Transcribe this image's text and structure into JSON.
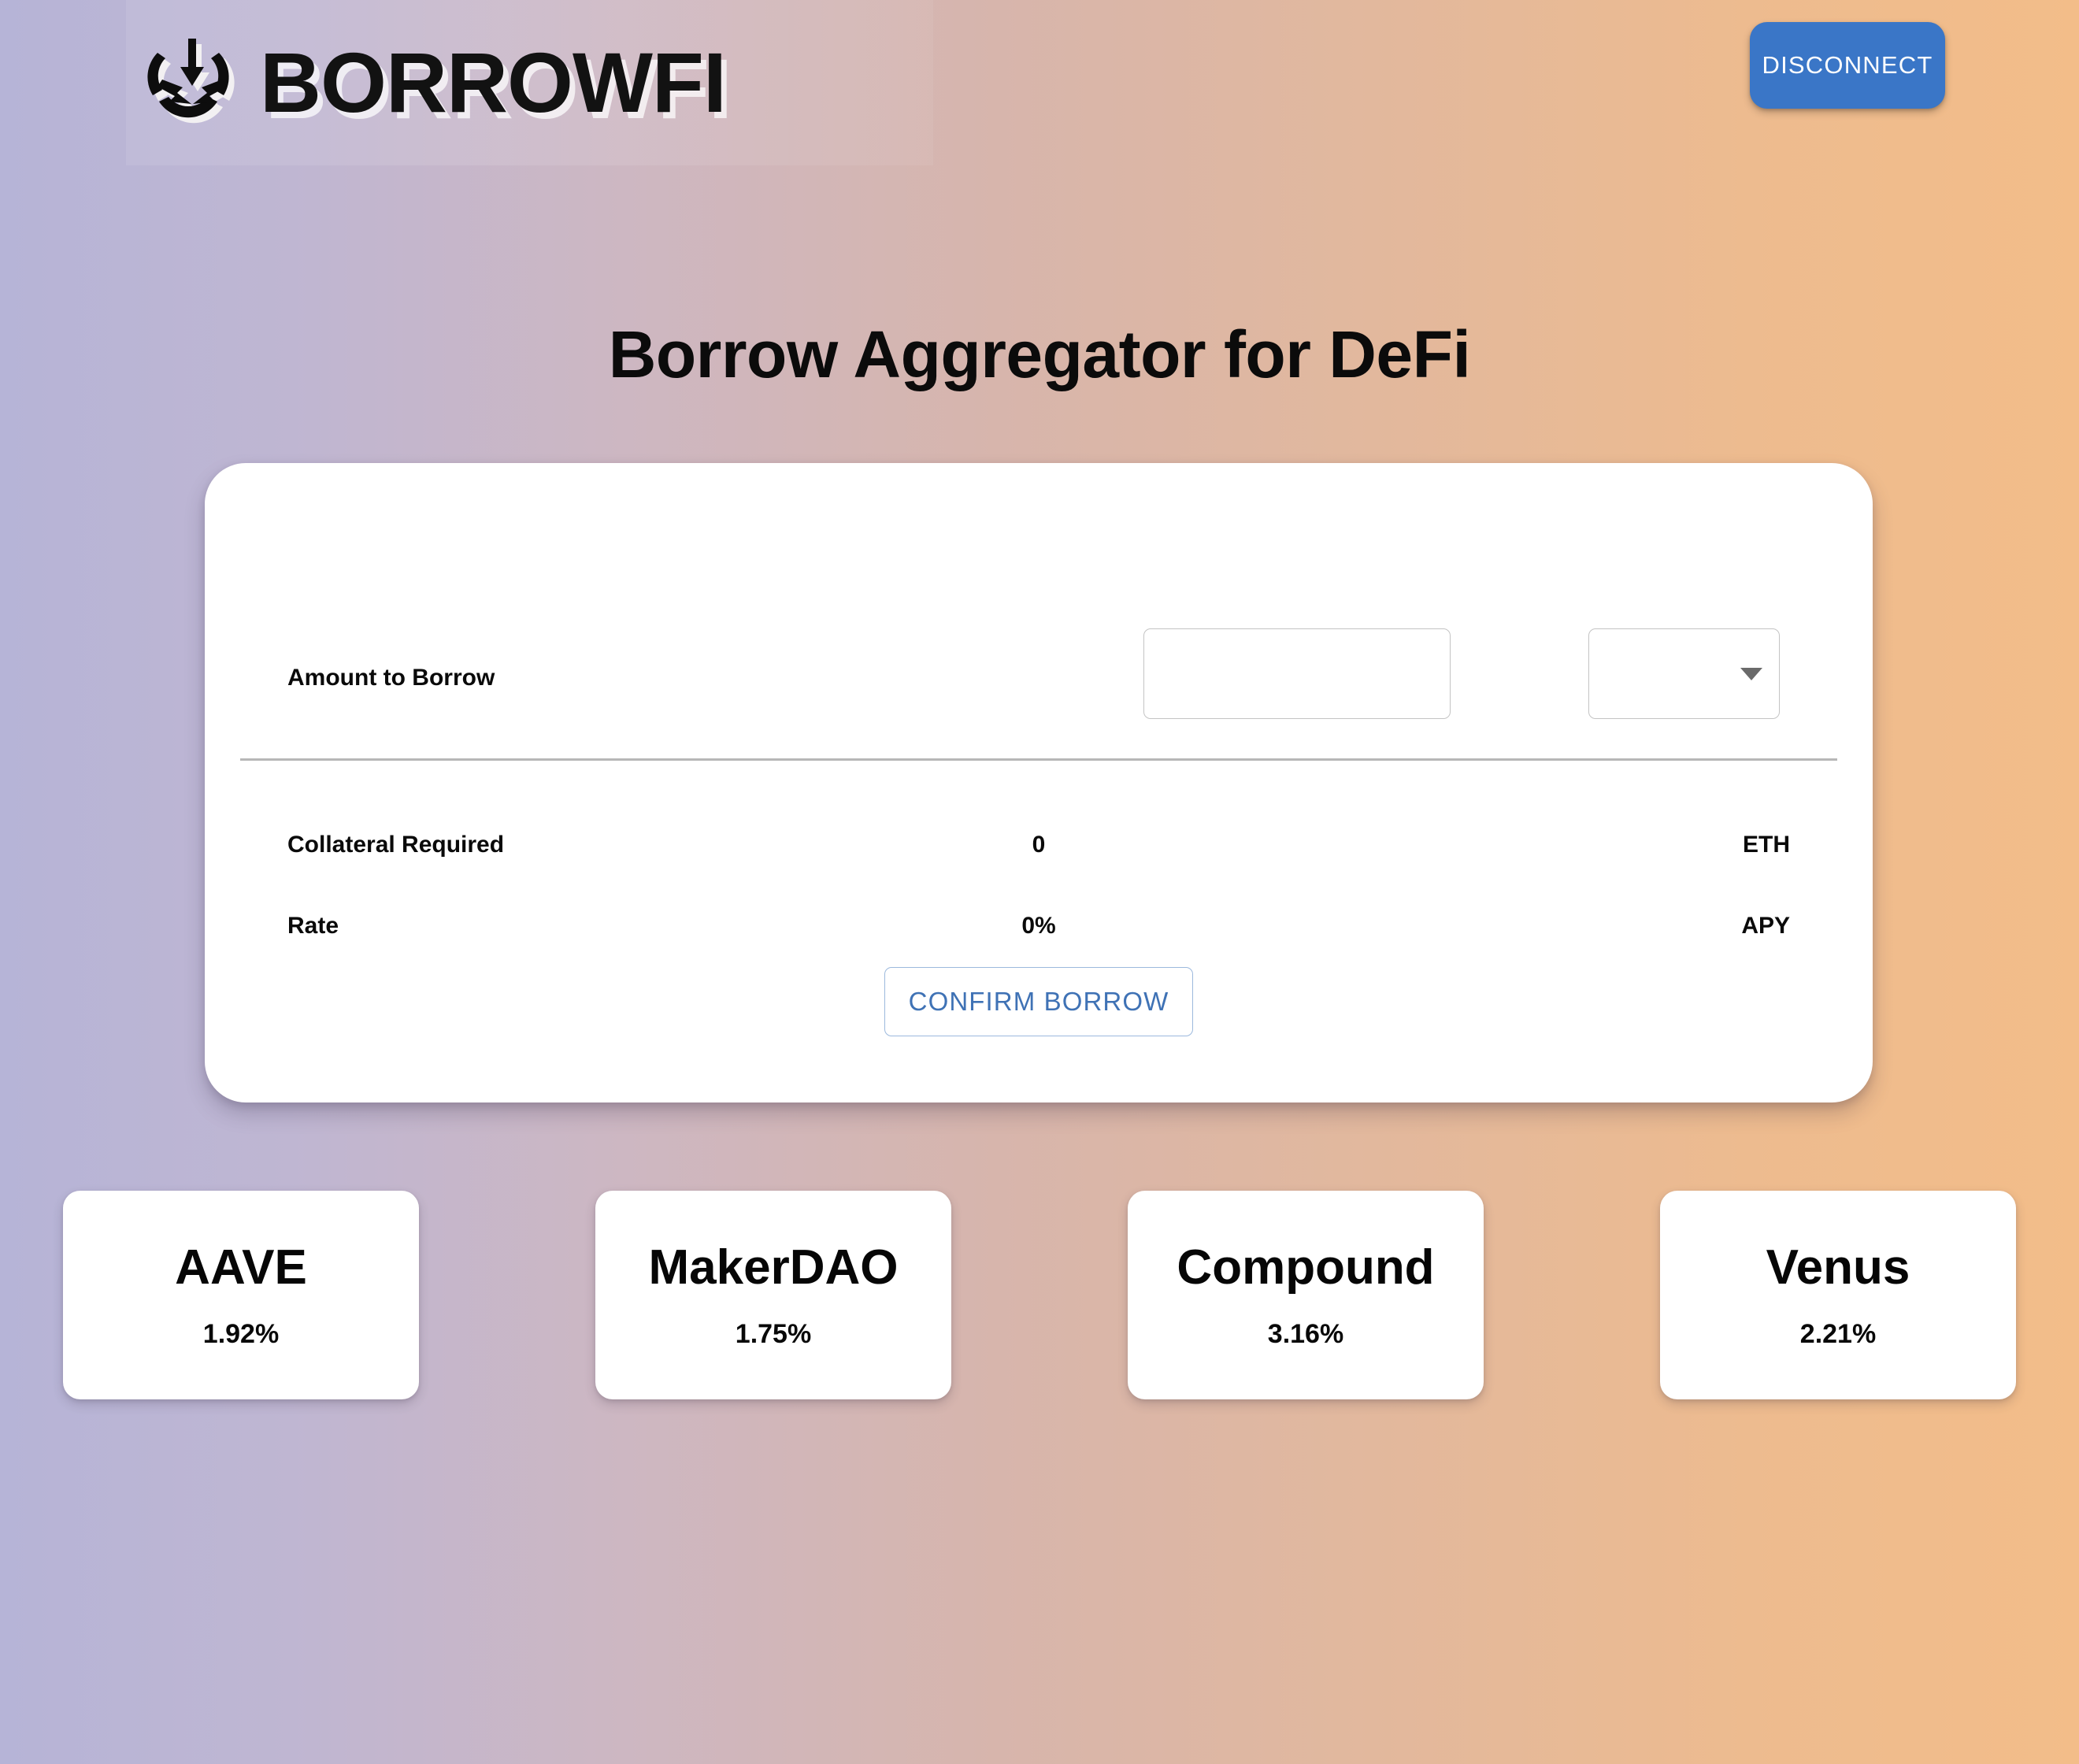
{
  "brand": {
    "name": "BORROWFI",
    "logo_icon": "aggregate-arrows-icon"
  },
  "header": {
    "disconnect_label": "DISCONNECT"
  },
  "page": {
    "title": "Borrow Aggregator for DeFi"
  },
  "form": {
    "amount_label": "Amount to Borrow",
    "amount_value": "",
    "amount_placeholder": "",
    "token_value": "",
    "collateral": {
      "label": "Collateral Required",
      "value": "0",
      "unit": "ETH"
    },
    "rate": {
      "label": "Rate",
      "value": "0%",
      "unit": "APY"
    },
    "confirm_label": "CONFIRM BORROW"
  },
  "protocols": [
    {
      "name": "AAVE",
      "rate": "1.92%"
    },
    {
      "name": "MakerDAO",
      "rate": "1.75%"
    },
    {
      "name": "Compound",
      "rate": "3.16%"
    },
    {
      "name": "Venus",
      "rate": "2.21%"
    }
  ],
  "colors": {
    "accent_blue": "#3a76c7",
    "outline_blue": "#3f72b5",
    "card_white": "#ffffff",
    "bg_left": "#b6b4d7",
    "bg_mid": "#d7b5ac",
    "bg_right": "#f3bd89"
  }
}
